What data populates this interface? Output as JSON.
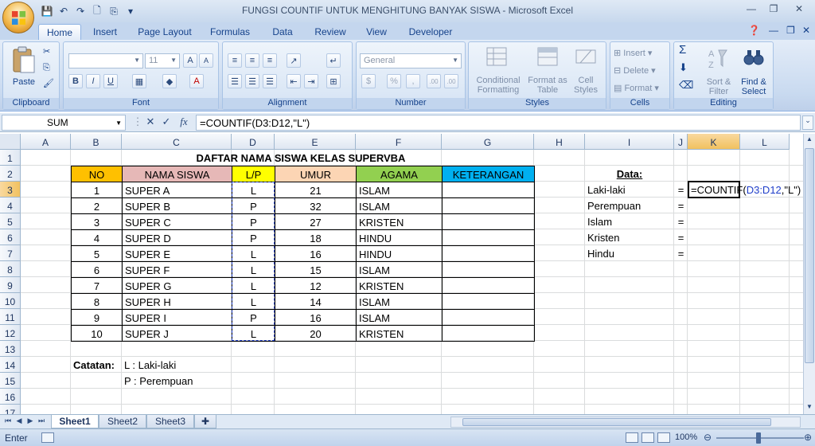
{
  "window": {
    "title": "FUNGSI COUNTIF UNTUK MENGHITUNG BANYAK SISWA - Microsoft Excel",
    "minimize": "—",
    "restore": "❐",
    "close": "✕"
  },
  "ribbon": {
    "tabs": [
      "Home",
      "Insert",
      "Page Layout",
      "Formulas",
      "Data",
      "Review",
      "View",
      "Developer"
    ],
    "active_tab": "Home",
    "groups": {
      "clipboard": {
        "label": "Clipboard",
        "paste": "Paste"
      },
      "font": {
        "label": "Font",
        "font_name": "",
        "font_size": "11",
        "bold": "B",
        "italic": "I",
        "underline": "U"
      },
      "alignment": {
        "label": "Alignment"
      },
      "number": {
        "label": "Number",
        "format": "General",
        "currency": "$",
        "percent": "%",
        "comma": ",",
        "inc_dec": ".00",
        "dec_dec": ".00"
      },
      "styles": {
        "label": "Styles",
        "conditional": "Conditional Formatting",
        "format_table": "Format as Table",
        "cell_styles": "Cell Styles"
      },
      "cells": {
        "label": "Cells",
        "insert": "Insert",
        "delete": "Delete",
        "format": "Format"
      },
      "editing": {
        "label": "Editing",
        "sigma": "Σ",
        "sort": "Sort & Filter",
        "find": "Find & Select"
      }
    }
  },
  "formula_bar": {
    "name_box": "SUM",
    "cancel": "✕",
    "enter": "✓",
    "fx": "fx",
    "formula": "=COUNTIF(D3:D12,\"L\")"
  },
  "columns": [
    "A",
    "B",
    "C",
    "D",
    "E",
    "F",
    "G",
    "H",
    "I",
    "J",
    "K",
    "L"
  ],
  "rows": [
    "1",
    "2",
    "3",
    "4",
    "5",
    "6",
    "7",
    "8",
    "9",
    "10",
    "11",
    "12",
    "13",
    "14",
    "15",
    "16",
    "17"
  ],
  "sheet": {
    "title": "DAFTAR NAMA SISWA KELAS SUPERVBA",
    "headers": [
      "NO",
      "NAMA SISWA",
      "L/P",
      "UMUR",
      "AGAMA",
      "KETERANGAN"
    ],
    "header_colors": [
      "#ffc000",
      "#e6b8b7",
      "#ffff00",
      "#fcd5b4",
      "#92d050",
      "#00b0f0"
    ],
    "students": [
      {
        "no": "1",
        "nama": "SUPER A",
        "lp": "L",
        "umur": "21",
        "agama": "ISLAM"
      },
      {
        "no": "2",
        "nama": "SUPER B",
        "lp": "P",
        "umur": "32",
        "agama": "ISLAM"
      },
      {
        "no": "3",
        "nama": "SUPER C",
        "lp": "P",
        "umur": "27",
        "agama": "KRISTEN"
      },
      {
        "no": "4",
        "nama": "SUPER D",
        "lp": "P",
        "umur": "18",
        "agama": "HINDU"
      },
      {
        "no": "5",
        "nama": "SUPER E",
        "lp": "L",
        "umur": "16",
        "agama": "HINDU"
      },
      {
        "no": "6",
        "nama": "SUPER F",
        "lp": "L",
        "umur": "15",
        "agama": "ISLAM"
      },
      {
        "no": "7",
        "nama": "SUPER G",
        "lp": "L",
        "umur": "12",
        "agama": "KRISTEN"
      },
      {
        "no": "8",
        "nama": "SUPER H",
        "lp": "L",
        "umur": "14",
        "agama": "ISLAM"
      },
      {
        "no": "9",
        "nama": "SUPER I",
        "lp": "P",
        "umur": "16",
        "agama": "ISLAM"
      },
      {
        "no": "10",
        "nama": "SUPER J",
        "lp": "L",
        "umur": "20",
        "agama": "KRISTEN"
      }
    ],
    "data_label": "Data:",
    "summary": [
      {
        "label": "Laki-laki",
        "eq": "="
      },
      {
        "label": "Perempuan",
        "eq": "="
      },
      {
        "label": "Islam",
        "eq": "="
      },
      {
        "label": "Kristen",
        "eq": "="
      },
      {
        "label": "Hindu",
        "eq": "="
      }
    ],
    "editing_cell": {
      "prefix": "=COUNTIF(",
      "range": "D3:D12",
      "suffix": ",\"L\")"
    },
    "notes_label": "Catatan:",
    "notes": [
      "L : Laki-laki",
      "P : Perempuan"
    ]
  },
  "sheet_tabs": [
    "Sheet1",
    "Sheet2",
    "Sheet3"
  ],
  "active_sheet": "Sheet1",
  "status": {
    "mode": "Enter",
    "zoom": "100%"
  },
  "colors": {
    "range_highlight": "#1f3ec9",
    "selected_header": "#f1c15f"
  }
}
